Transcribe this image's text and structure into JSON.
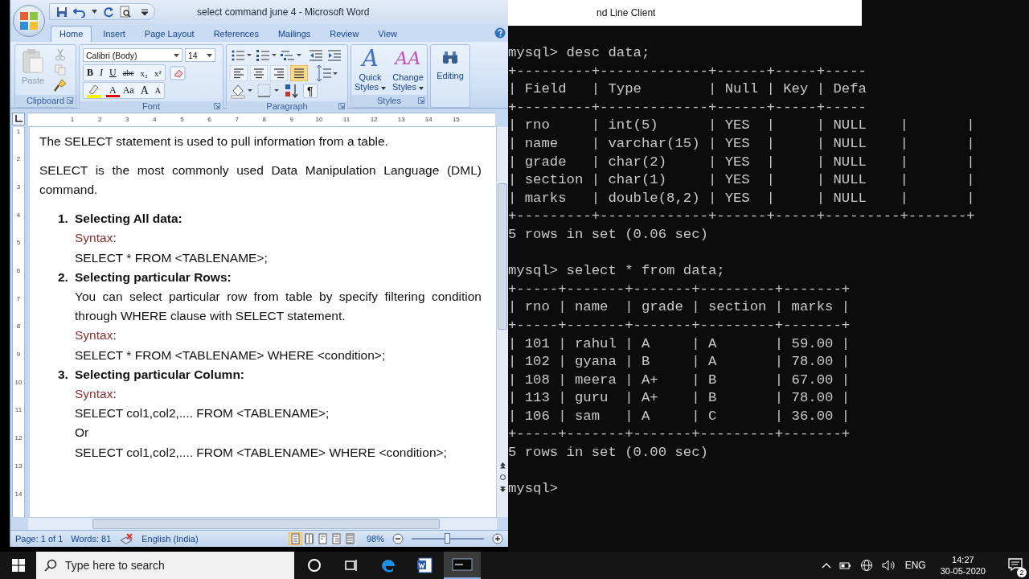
{
  "word": {
    "title": "select command june 4 - Microsoft Word",
    "tabs": [
      {
        "label": "Home",
        "selected": true
      },
      {
        "label": "Insert",
        "selected": false
      },
      {
        "label": "Page Layout",
        "selected": false
      },
      {
        "label": "References",
        "selected": false
      },
      {
        "label": "Mailings",
        "selected": false
      },
      {
        "label": "Review",
        "selected": false
      },
      {
        "label": "View",
        "selected": false
      }
    ],
    "ribbon": {
      "clipboard": {
        "label": "Clipboard",
        "paste": "Paste"
      },
      "font": {
        "label": "Font",
        "name": "Calibri (Body)",
        "size": "14",
        "row1": [
          {
            "kind": "bold",
            "text": "B"
          },
          {
            "kind": "italic",
            "text": "I"
          },
          {
            "kind": "underline",
            "text": "U"
          },
          {
            "kind": "strike",
            "text": "abc"
          },
          {
            "kind": "sub",
            "text": "x₂"
          },
          {
            "kind": "sup",
            "text": "x²"
          }
        ],
        "row2": [
          {
            "kind": "color",
            "text": "A"
          },
          {
            "kind": "case",
            "text": "Aa"
          },
          {
            "kind": "grow",
            "text": "A"
          },
          {
            "kind": "shrink",
            "text": "A"
          }
        ]
      },
      "paragraph": {
        "label": "Paragraph",
        "align": [
          {
            "kind": "left",
            "selected": false
          },
          {
            "kind": "center",
            "selected": false
          },
          {
            "kind": "right",
            "selected": false
          },
          {
            "kind": "justify",
            "selected": true
          }
        ],
        "pilcrow": "¶"
      },
      "styles": {
        "label": "Styles",
        "quick_glyph": "A",
        "quick": "Quick",
        "quick2": "Styles",
        "change_glyph": "AA",
        "change": "Change",
        "change2": "Styles"
      },
      "editing": {
        "label": "Editing"
      }
    },
    "ruler": [
      "1",
      "2",
      "3",
      "4",
      "5",
      "6",
      "7",
      "8",
      "9",
      "10",
      "11",
      "12",
      "13",
      "14",
      "15"
    ],
    "vruler": [
      "1",
      "2",
      "3",
      "4",
      "5",
      "6",
      "7",
      "8",
      "9",
      "10",
      "11",
      "12",
      "13",
      "14"
    ],
    "document": [
      {
        "kind": "para",
        "text": "The SELECT statement is used to pull information from a table."
      },
      {
        "kind": "para",
        "text": "SELECT is the most commonly used Data Manipulation Language (DML) command."
      },
      {
        "kind": "item",
        "number": "1.",
        "heading": "Selecting All data:",
        "lines": [
          {
            "kind": "syntax",
            "label": "Syntax",
            "tail": ":"
          },
          {
            "kind": "code",
            "text": "SELECT * FROM <TABLENAME>;"
          }
        ]
      },
      {
        "kind": "item",
        "number": "2.",
        "heading": "Selecting particular Rows:",
        "lines": [
          {
            "kind": "text",
            "text": "You can select particular row from table by specify filtering condition through WHERE clause with SELECT statement."
          },
          {
            "kind": "syntax",
            "label": "Syntax",
            "tail": ":"
          },
          {
            "kind": "code",
            "text": "SELECT * FROM <TABLENAME> WHERE <condition>;"
          }
        ]
      },
      {
        "kind": "item",
        "number": "3.",
        "heading": "Selecting particular Column:",
        "lines": [
          {
            "kind": "syntax",
            "label": "Syntax",
            "tail": ":"
          },
          {
            "kind": "code",
            "text": "SELECT col1,col2,.... FROM <TABLENAME>;"
          },
          {
            "kind": "code",
            "text": "Or"
          },
          {
            "kind": "code",
            "text": "SELECT col1,col2,.... FROM <TABLENAME> WHERE <condition>;"
          }
        ]
      }
    ],
    "status": {
      "page": "Page: 1 of 1",
      "words": "Words: 81",
      "language": "English (India)",
      "views": [
        {
          "kind": "print",
          "selected": true
        },
        {
          "kind": "reading",
          "selected": false
        },
        {
          "kind": "web",
          "selected": false
        },
        {
          "kind": "outline",
          "selected": false
        },
        {
          "kind": "draft",
          "selected": false
        }
      ],
      "zoom": "98%",
      "zoom_slider": {
        "level": 0.49
      }
    }
  },
  "terminal": {
    "title": "nd Line Client",
    "blocks": [
      [
        "mysql> desc data;",
        "+---------+-------------+------+-----+-----",
        "| Field   | Type        | Null | Key | Defa",
        "+---------+-------------+------+-----+-----",
        "| rno     | int(5)      | YES  |     | NULL    |       |",
        "| name    | varchar(15) | YES  |     | NULL    |       |",
        "| grade   | char(2)     | YES  |     | NULL    |       |",
        "| section | char(1)     | YES  |     | NULL    |       |",
        "| marks   | double(8,2) | YES  |     | NULL    |       |",
        "+---------+-------------+------+-----+---------+-------+",
        "5 rows in set (0.06 sec)"
      ],
      [
        "mysql> select * from data;",
        "+-----+-------+-------+---------+-------+",
        "| rno | name  | grade | section | marks |",
        "+-----+-------+-------+---------+-------+",
        "| 101 | rahul | A     | A       | 59.00 |",
        "| 102 | gyana | B     | A       | 78.00 |",
        "| 108 | meera | A+    | B       | 67.00 |",
        "| 113 | guru  | A+    | B       | 78.00 |",
        "| 106 | sam   | A     | C       | 36.00 |",
        "+-----+-------+-------+---------+-------+",
        "5 rows in set (0.00 sec)"
      ],
      [
        "mysql>"
      ]
    ]
  },
  "taskbar": {
    "search_placeholder": "Type here to search",
    "apps": [
      {
        "kind": "cortana",
        "selected": false
      },
      {
        "kind": "taskview",
        "selected": false
      },
      {
        "kind": "edge",
        "selected": false
      },
      {
        "kind": "word",
        "selected": false
      },
      {
        "kind": "mysql",
        "selected": true
      }
    ],
    "language": "ENG",
    "time": "14:27",
    "date": "30-05-2020",
    "notifications": "2"
  }
}
